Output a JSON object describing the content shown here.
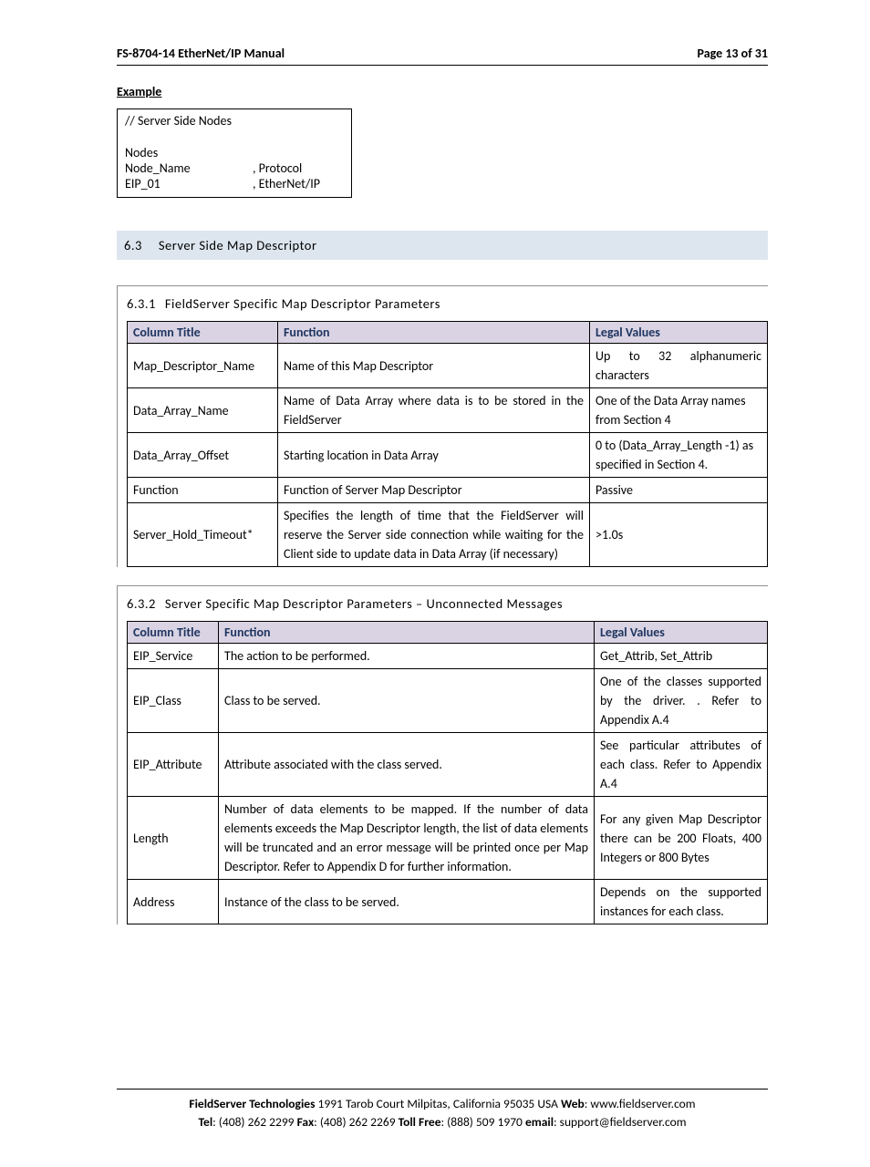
{
  "header": {
    "left": "FS-8704-14 EtherNet/IP Manual",
    "right": "Page 13 of 31"
  },
  "example": {
    "label": "Example",
    "line1": "//     Server Side Nodes",
    "nodes_label": "Nodes",
    "r1c1": "Node_Name",
    "r1c2": ", Protocol",
    "r2c1": "EIP_01",
    "r2c2": ", EtherNet/IP"
  },
  "section63": {
    "num": "6.3",
    "title": "Server Side Map Descriptor"
  },
  "section631": {
    "num": "6.3.1",
    "title": "FieldServer Specific Map Descriptor Parameters",
    "headers": {
      "c1": "Column Title",
      "c2": "Function",
      "c3": "Legal Values"
    },
    "rows": [
      {
        "c1": "Map_Descriptor_Name",
        "c2": "Name of this Map Descriptor",
        "c3": "Up to 32 alphanumeric characters"
      },
      {
        "c1": "Data_Array_Name",
        "c2": "Name of Data Array where data is to be stored in the FieldServer",
        "c3": "One of the Data Array names from Section 4"
      },
      {
        "c1": "Data_Array_Offset",
        "c2": "Starting location in Data Array",
        "c3": "0 to (Data_Array_Length -1) as specified in Section 4."
      },
      {
        "c1": "Function",
        "c2": "Function of Server Map Descriptor",
        "c3": "Passive"
      },
      {
        "c1": "Server_Hold_Timeout*",
        "c2": "Specifies the length of time that the FieldServer will reserve the Server side connection while waiting for the Client side to update data in Data Array (if necessary)",
        "c3": ">1.0s"
      }
    ]
  },
  "section632": {
    "num": "6.3.2",
    "title": "Server Specific Map Descriptor Parameters – Unconnected Messages",
    "headers": {
      "c1": "Column Title",
      "c2": "Function",
      "c3": "Legal Values"
    },
    "rows": [
      {
        "c1": "EIP_Service",
        "c2": "The action to be performed.",
        "c3": "Get_Attrib, Set_Attrib"
      },
      {
        "c1": "EIP_Class",
        "c2": "Class to be served.",
        "c3": "One of the classes supported by the driver. . Refer to Appendix A.4"
      },
      {
        "c1": "EIP_Attribute",
        "c2": "Attribute associated with the class served.",
        "c3": "See particular attributes of each class.  Refer to Appendix A.4"
      },
      {
        "c1": "Length",
        "c2": "Number of data elements to be mapped.  If the number of data elements exceeds the Map Descriptor length, the list of data elements will be truncated and an error message will be printed once per Map Descriptor.  Refer to Appendix D for further information.",
        "c3": "For any given Map Descriptor there can be 200 Floats, 400 Integers or 800 Bytes"
      },
      {
        "c1": "Address",
        "c2": "Instance of the class to be served.",
        "c3": "Depends on the supported instances for each class."
      }
    ]
  },
  "footer": {
    "company": "FieldServer Technologies",
    "addr": " 1991 Tarob Court Milpitas, California 95035 USA   ",
    "web_l": "Web",
    "web_v": ": www.fieldserver.com",
    "tel_l": "Tel",
    "tel_v": ": (408) 262 2299   ",
    "fax_l": "Fax",
    "fax_v": ": (408) 262 2269   ",
    "tf_l": "Toll Free",
    "tf_v": ": (888) 509 1970   ",
    "em_l": "email",
    "em_v": ": support@fieldserver.com"
  }
}
